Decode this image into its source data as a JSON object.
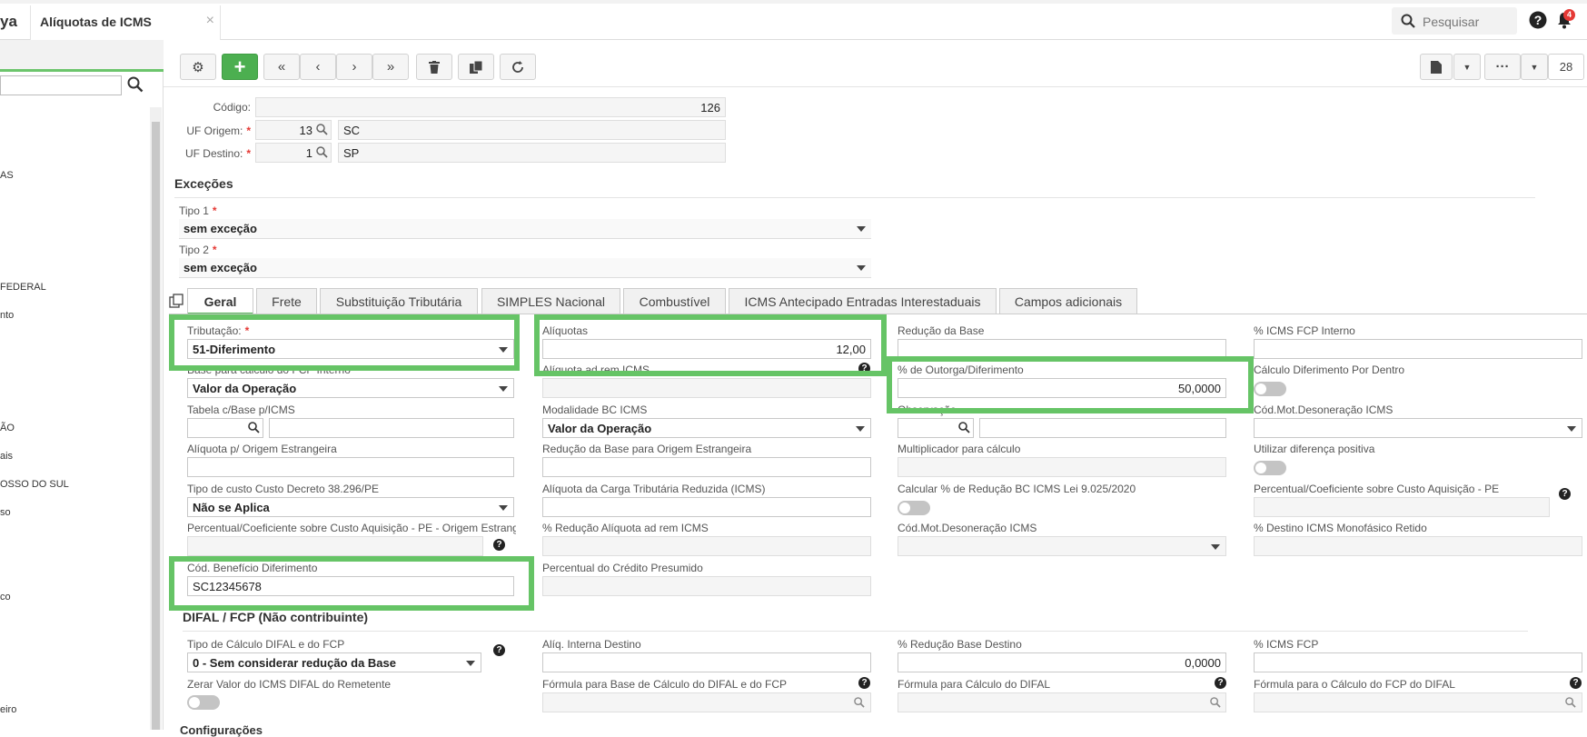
{
  "app": {
    "brand": "ya",
    "tab_title": "Alíquotas de ICMS",
    "tab_close": "×",
    "search_placeholder": "Pesquisar",
    "notifications_count": "4"
  },
  "toolbar": {
    "page_number": "28"
  },
  "left_list": [
    {
      "label": "AS"
    },
    {
      "label": "FEDERAL"
    },
    {
      "label": "nto"
    },
    {
      "label": "ÃO"
    },
    {
      "label": "ais"
    },
    {
      "label": "OSSO DO SUL"
    },
    {
      "label": "so"
    },
    {
      "label": "co"
    },
    {
      "label": "eiro"
    }
  ],
  "header": {
    "codigo_label": "Código:",
    "codigo_value": "126",
    "uf_origem_label": "UF Origem:",
    "uf_origem_code": "13",
    "uf_origem_name": "SC",
    "uf_destino_label": "UF Destino:",
    "uf_destino_code": "1",
    "uf_destino_name": "SP",
    "required": "*"
  },
  "excecoes": {
    "title": "Exceções",
    "tipo1_label": "Tipo 1",
    "tipo1_value": "sem exceção",
    "tipo2_label": "Tipo 2",
    "tipo2_value": "sem exceção"
  },
  "tabs": [
    {
      "label": "Geral"
    },
    {
      "label": "Frete"
    },
    {
      "label": "Substituição Tributária"
    },
    {
      "label": "SIMPLES Nacional"
    },
    {
      "label": "Combustível"
    },
    {
      "label": "ICMS Antecipado Entradas Interestaduais"
    },
    {
      "label": "Campos adicionais"
    }
  ],
  "geral": {
    "tributacao_label": "Tributação:",
    "tributacao_value": "51-Diferimento",
    "aliquotas_label": "Alíquotas",
    "aliquotas_value": "12,00",
    "reducao_base_label": "Redução da Base",
    "icms_fcp_interno_label": "% ICMS FCP Interno",
    "base_fcp_label": "Base para cálculo do FCP Interno",
    "base_fcp_value": "Valor da Operação",
    "aliquota_ad_rem_label": "Alíquota ad rem ICMS",
    "outorga_label": "% de Outorga/Diferimento",
    "outorga_value": "50,0000",
    "calc_diferimento_label": "Cálculo Diferimento Por Dentro",
    "tabela_base_label": "Tabela c/Base p/ICMS",
    "modalidade_label": "Modalidade BC ICMS",
    "modalidade_value": "Valor da Operação",
    "observacao_label": "Observação",
    "cod_mot_deson_label": "Cód.Mot.Desoneração ICMS",
    "aliq_origem_estr_label": "Alíquota p/ Origem Estrangeira",
    "red_base_origem_label": "Redução da Base para Origem Estrangeira",
    "multiplicador_label": "Multiplicador para cálculo",
    "diferenca_positiva_label": "Utilizar diferença positiva",
    "tipo_custo_label": "Tipo de custo Custo Decreto 38.296/PE",
    "tipo_custo_value": "Não se Aplica",
    "aliq_carga_label": "Alíquota da Carga Tributária Reduzida (ICMS)",
    "calc_reducao_label": "Calcular % de Redução BC ICMS Lei 9.025/2020",
    "perc_coef_label": "Percentual/Coeficiente sobre Custo Aquisição - PE",
    "perc_coef_origem_label": "Percentual/Coeficiente sobre Custo Aquisição - PE - Origem Estrang",
    "red_aliq_ad_rem_label": "% Redução Alíquota ad rem ICMS",
    "cod_mot_deson2_label": "Cód.Mot.Desoneração ICMS",
    "destino_monofasico_label": "% Destino ICMS Monofásico Retido",
    "cod_beneficio_label": "Cód. Benefício Diferimento",
    "cod_beneficio_value": "SC12345678",
    "perc_credito_label": "Percentual do Crédito Presumido"
  },
  "difal": {
    "title": "DIFAL / FCP (Não contribuinte)",
    "tipo_calc_label": "Tipo de Cálculo DIFAL e do FCP",
    "tipo_calc_value": "0 - Sem considerar redução da Base",
    "aliq_interna_label": "Alíq. Interna Destino",
    "red_base_destino_label": "% Redução Base Destino",
    "red_base_destino_value": "0,0000",
    "icms_fcp_label": "% ICMS FCP",
    "zerar_label": "Zerar Valor do ICMS DIFAL do Remetente",
    "formula_base_label": "Fórmula para Base de Cálculo do DIFAL e do FCP",
    "formula_difal_label": "Fórmula para Cálculo do DIFAL",
    "formula_fcp_label": "Fórmula para o Cálculo do FCP do DIFAL",
    "next_section": "Configurações"
  },
  "colors": {
    "accent_green": "#4caf50",
    "highlight_green": "#66c466",
    "required_red": "#e53935"
  }
}
